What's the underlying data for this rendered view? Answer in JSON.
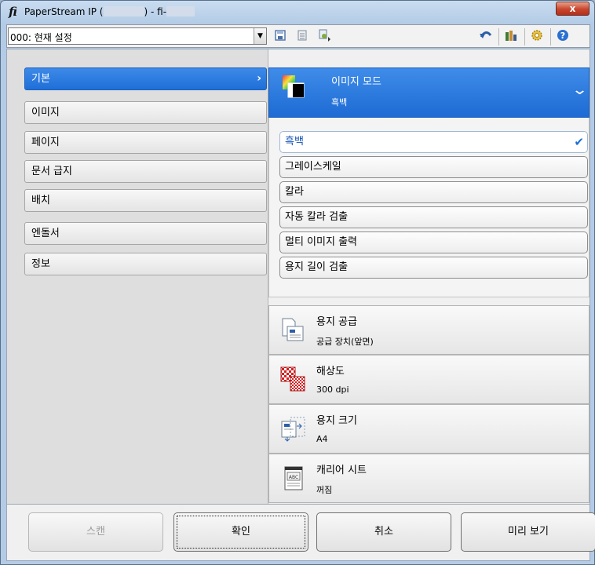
{
  "window": {
    "logo": "fi",
    "title": "PaperStream IP (",
    "title_mid": ") - fi-",
    "close_label": "x"
  },
  "toolbar": {
    "profile_value": "000: 현재 설정",
    "icons": [
      "save-icon",
      "delete-icon",
      "export-icon",
      "undo-icon",
      "sdk-icon",
      "settings-gear-icon",
      "help-icon"
    ]
  },
  "nav": {
    "items": [
      {
        "label": "기본"
      },
      {
        "label": "이미지"
      },
      {
        "label": "페이지"
      },
      {
        "label": "문서 급지"
      },
      {
        "label": "배치"
      },
      {
        "label": "엔돌서"
      },
      {
        "label": "정보"
      }
    ],
    "active_index": 0
  },
  "image_mode": {
    "title": "이미지 모드",
    "value": "흑백",
    "options": [
      "흑백",
      "그레이스케일",
      "칼라",
      "자동 칼라 검출",
      "멀티 이미지 출력",
      "용지 길이 검출"
    ],
    "selected_index": 0
  },
  "settings": [
    {
      "title": "용지 공급",
      "value": "공급 장치(앞면)",
      "icon": "paper-source-icon"
    },
    {
      "title": "해상도",
      "value": "300 dpi",
      "icon": "resolution-icon"
    },
    {
      "title": "용지 크기",
      "value": "A4",
      "icon": "paper-size-icon"
    },
    {
      "title": "캐리어 시트",
      "value": "꺼짐",
      "icon": "carrier-sheet-icon"
    }
  ],
  "buttons": {
    "scan": "스캔",
    "ok": "확인",
    "cancel": "취소",
    "preview": "미리 보기"
  },
  "colors": {
    "accent": "#1e6fd8",
    "check": "#1d6fd8"
  }
}
